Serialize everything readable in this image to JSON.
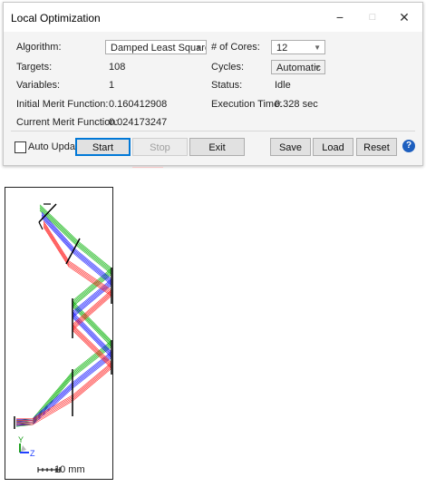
{
  "window": {
    "title": "Local Optimization",
    "controls": {
      "minimize": "−",
      "maximize": "□",
      "close": "✕"
    }
  },
  "fields": {
    "algorithm_label": "Algorithm:",
    "algorithm_value": "Damped Least Squares",
    "cores_label": "# of Cores:",
    "cores_value": "12",
    "targets_label": "Targets:",
    "targets_value": "108",
    "cycles_label": "Cycles:",
    "cycles_value": "Automatic",
    "variables_label": "Variables:",
    "variables_value": "1",
    "status_label": "Status:",
    "status_value": "Idle",
    "initial_merit_label": "Initial Merit Function:",
    "initial_merit_value": "0.160412908",
    "exec_time_label": "Execution Time:",
    "exec_time_value": "0.328 sec",
    "current_merit_label": "Current Merit Function:",
    "current_merit_value": "0.024173247"
  },
  "buttons": {
    "auto_update_label": "Auto Update",
    "start": "Start",
    "stop": "Stop",
    "exit": "Exit",
    "save": "Save",
    "load": "Load",
    "reset": "Reset",
    "help": "?"
  },
  "layout_plot": {
    "axis_y": "Y",
    "axis_z": "Z",
    "scale_label": "10 mm",
    "ray_colors": {
      "green": "#00b000",
      "blue": "#1010ff",
      "red": "#ff2020",
      "element": "#000000"
    }
  }
}
